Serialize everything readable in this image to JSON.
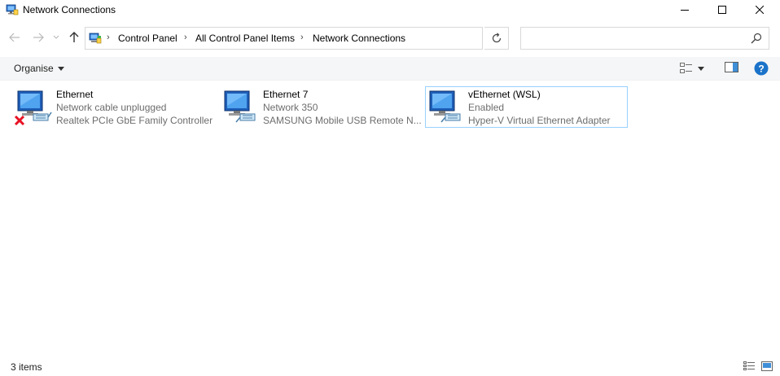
{
  "window": {
    "title": "Network Connections"
  },
  "breadcrumb": {
    "items": [
      "Control Panel",
      "All Control Panel Items",
      "Network Connections"
    ],
    "separator": "›"
  },
  "search": {
    "placeholder": "",
    "value": ""
  },
  "commandbar": {
    "organise_label": "Organise"
  },
  "connections": [
    {
      "name": "Ethernet",
      "status": "Network cable unplugged",
      "device": "Realtek PCIe GbE Family Controller",
      "disconnected": true,
      "selected": false
    },
    {
      "name": "Ethernet 7",
      "status": "Network 350",
      "device": "SAMSUNG Mobile USB Remote N...",
      "disconnected": false,
      "selected": false
    },
    {
      "name": "vEthernet (WSL)",
      "status": "Enabled",
      "device": "Hyper-V Virtual Ethernet Adapter",
      "disconnected": false,
      "selected": true
    }
  ],
  "statusbar": {
    "item_count": "3 items"
  },
  "colors": {
    "accent": "#0078d7",
    "help": "#1a73c9",
    "selection_border": "#99d1ff",
    "disconnected_x": "#e81123"
  },
  "icons": {
    "app": "network-connections-icon",
    "back": "back-arrow-icon",
    "forward": "forward-arrow-icon",
    "up": "up-arrow-icon",
    "refresh": "refresh-icon",
    "search": "search-icon",
    "help": "help-icon"
  }
}
